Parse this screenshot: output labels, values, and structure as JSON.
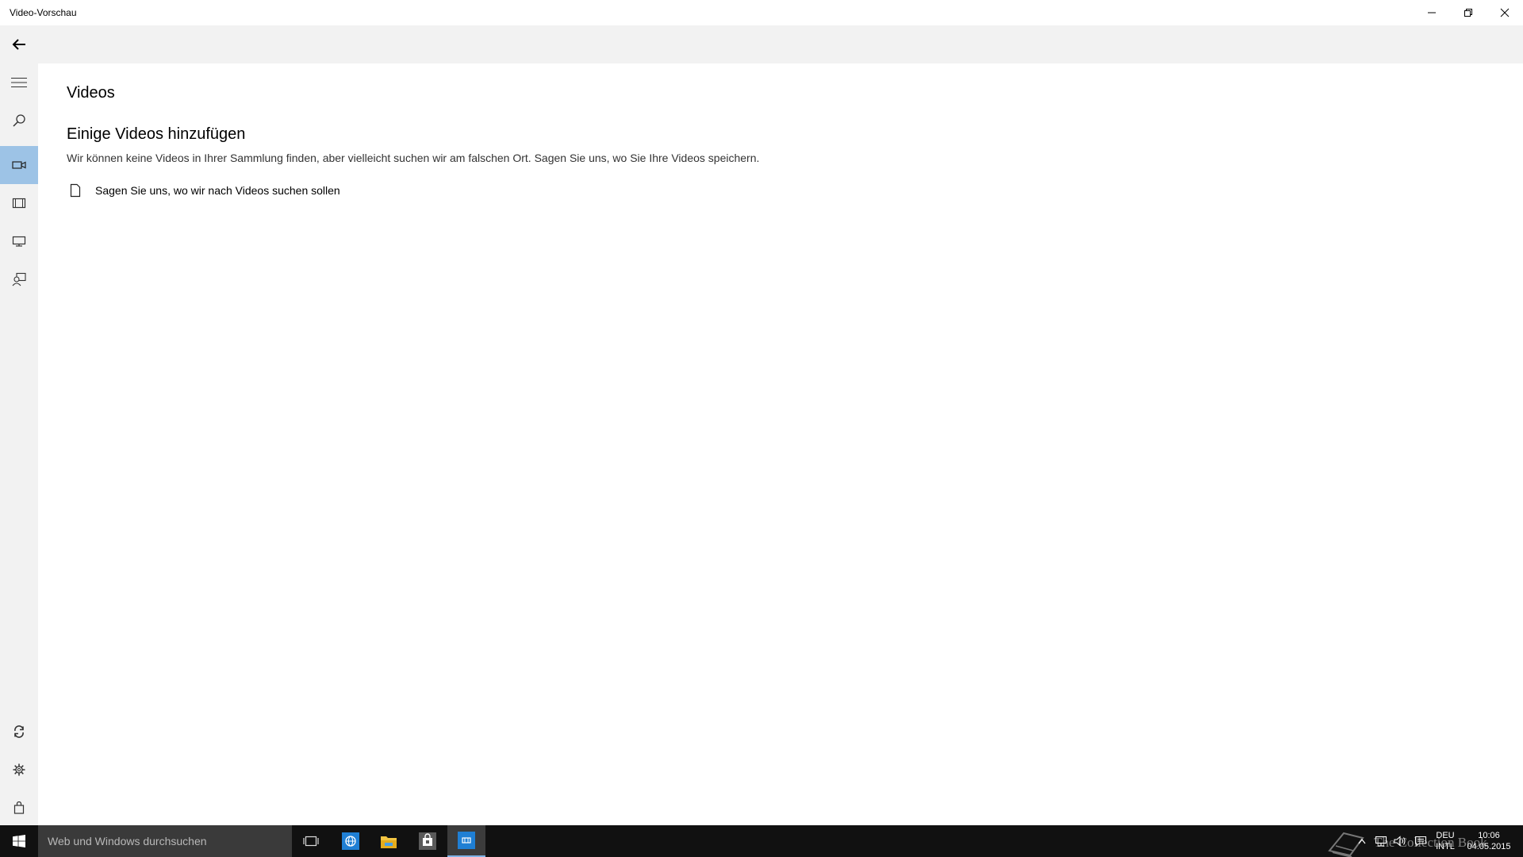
{
  "window": {
    "title": "Video-Vorschau",
    "controls": {
      "minimize": "minimize-icon",
      "maximize": "restore-icon",
      "close": "close-icon"
    }
  },
  "nav": {
    "items": [
      {
        "icon": "hamburger-icon"
      },
      {
        "icon": "search-icon"
      },
      {
        "icon": "video-camera-icon",
        "selected": true
      },
      {
        "icon": "film-icon"
      },
      {
        "icon": "tv-icon"
      },
      {
        "icon": "people-icon"
      }
    ],
    "bottom": [
      {
        "icon": "sync-icon"
      },
      {
        "icon": "gear-icon"
      },
      {
        "icon": "store-bag-icon"
      }
    ],
    "selected_color": "#9dc3e6"
  },
  "content": {
    "page_title": "Videos",
    "section_title": "Einige Videos hinzufügen",
    "description": "Wir können keine Videos in Ihrer Sammlung finden, aber vielleicht suchen wir am falschen Ort. Sagen Sie uns, wo Sie Ihre Videos speichern.",
    "folder_link": "Sagen Sie uns, wo wir nach Videos suchen sollen"
  },
  "taskbar": {
    "search_placeholder": "Web und Windows durchsuchen",
    "apps": [
      "task-view-icon",
      "browser-icon",
      "file-explorer-icon",
      "store-icon",
      "video-app-icon"
    ],
    "tray": {
      "language": "DEU",
      "layout": "INTL",
      "time": "10:06",
      "date": "04.05.2015"
    },
    "watermark": "The Collection Book"
  }
}
